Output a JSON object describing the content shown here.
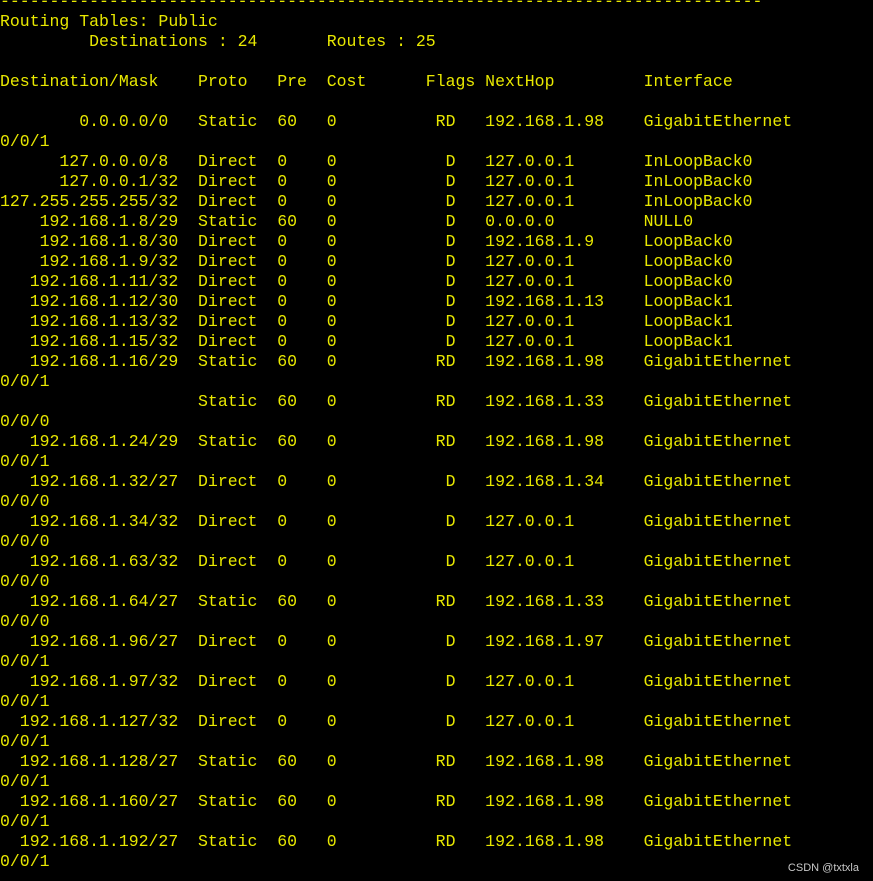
{
  "colors": {
    "background": "#000000",
    "terminal_text": "#e8e800",
    "watermark_text": "#c8c8c8"
  },
  "terminal": {
    "lines": [
      "-----------------------------------------------------------------------------",
      "Routing Tables: Public",
      "         Destinations : 24       Routes : 25",
      "",
      "Destination/Mask    Proto   Pre  Cost      Flags NextHop         Interface",
      "",
      "        0.0.0.0/0   Static  60   0          RD   192.168.1.98    GigabitEthernet",
      "0/0/1",
      "      127.0.0.0/8   Direct  0    0           D   127.0.0.1       InLoopBack0",
      "      127.0.0.1/32  Direct  0    0           D   127.0.0.1       InLoopBack0",
      "127.255.255.255/32  Direct  0    0           D   127.0.0.1       InLoopBack0",
      "    192.168.1.8/29  Static  60   0           D   0.0.0.0         NULL0",
      "    192.168.1.8/30  Direct  0    0           D   192.168.1.9     LoopBack0",
      "    192.168.1.9/32  Direct  0    0           D   127.0.0.1       LoopBack0",
      "   192.168.1.11/32  Direct  0    0           D   127.0.0.1       LoopBack0",
      "   192.168.1.12/30  Direct  0    0           D   192.168.1.13    LoopBack1",
      "   192.168.1.13/32  Direct  0    0           D   127.0.0.1       LoopBack1",
      "   192.168.1.15/32  Direct  0    0           D   127.0.0.1       LoopBack1",
      "   192.168.1.16/29  Static  60   0          RD   192.168.1.98    GigabitEthernet",
      "0/0/1",
      "                    Static  60   0          RD   192.168.1.33    GigabitEthernet",
      "0/0/0",
      "   192.168.1.24/29  Static  60   0          RD   192.168.1.98    GigabitEthernet",
      "0/0/1",
      "   192.168.1.32/27  Direct  0    0           D   192.168.1.34    GigabitEthernet",
      "0/0/0",
      "   192.168.1.34/32  Direct  0    0           D   127.0.0.1       GigabitEthernet",
      "0/0/0",
      "   192.168.1.63/32  Direct  0    0           D   127.0.0.1       GigabitEthernet",
      "0/0/0",
      "   192.168.1.64/27  Static  60   0          RD   192.168.1.33    GigabitEthernet",
      "0/0/0",
      "   192.168.1.96/27  Direct  0    0           D   192.168.1.97    GigabitEthernet",
      "0/0/1",
      "   192.168.1.97/32  Direct  0    0           D   127.0.0.1       GigabitEthernet",
      "0/0/1",
      "  192.168.1.127/32  Direct  0    0           D   127.0.0.1       GigabitEthernet",
      "0/0/1",
      "  192.168.1.128/27  Static  60   0          RD   192.168.1.98    GigabitEthernet",
      "0/0/1",
      "  192.168.1.160/27  Static  60   0          RD   192.168.1.98    GigabitEthernet",
      "0/0/1",
      "  192.168.1.192/27  Static  60   0          RD   192.168.1.98    GigabitEthernet",
      "0/0/1"
    ]
  },
  "watermark": {
    "text": "CSDN @txtxla"
  }
}
